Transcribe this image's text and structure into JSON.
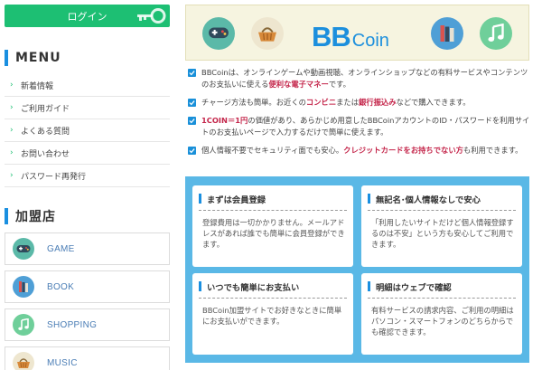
{
  "sidebar": {
    "login_label": "ログイン",
    "menu_title": "MENU",
    "menu_items": [
      "新着情報",
      "ご利用ガイド",
      "よくある質問",
      "お問い合わせ",
      "パスワード再発行"
    ],
    "shops_title": "加盟店",
    "shops": [
      {
        "label": "GAME",
        "icon": "gamepad-icon"
      },
      {
        "label": "BOOK",
        "icon": "books-icon"
      },
      {
        "label": "SHOPPING",
        "icon": "music-note-icon"
      },
      {
        "label": "MUSIC",
        "icon": "basket-icon"
      }
    ]
  },
  "banner": {
    "logo_bb": "BB",
    "logo_coin": "Coin",
    "icons": [
      "gamepad-icon",
      "basket-icon",
      "books-icon",
      "music-note-icon"
    ]
  },
  "features": [
    {
      "parts": [
        {
          "t": "BBCoinは、オンラインゲームや動画視聴、オンラインショップなどの有料サービスやコンテンツのお支払いに使える"
        },
        {
          "t": "便利な電子マネー",
          "hl": true
        },
        {
          "t": "です。"
        }
      ]
    },
    {
      "parts": [
        {
          "t": "チャージ方法も簡単。お近くの"
        },
        {
          "t": "コンビニ",
          "hl": true
        },
        {
          "t": "または"
        },
        {
          "t": "銀行振込み",
          "hl": true
        },
        {
          "t": "などで購入できます。"
        }
      ]
    },
    {
      "parts": [
        {
          "t": "1COIN＝1円",
          "hl": true
        },
        {
          "t": "の価値があり、あらかじめ用意したBBCoinアカウントのID・パスワードを利用サイトのお支払いページで入力するだけで簡単に使えます。"
        }
      ]
    },
    {
      "parts": [
        {
          "t": "個人情報不要でセキュリティ面でも安心。"
        },
        {
          "t": "クレジットカードをお持ちでない方",
          "hl": true
        },
        {
          "t": "も利用できます。"
        }
      ]
    }
  ],
  "cards": [
    {
      "title": "まずは会員登録",
      "body": "登録費用は一切かかりません。メールアドレスがあれば誰でも簡単に会員登録ができます。"
    },
    {
      "title": "無記名･個人情報なしで安心",
      "body": "「利用したいサイトだけど個人情報登録するのは不安」という方も安心してご利用できます。"
    },
    {
      "title": "いつでも簡単にお支払い",
      "body": "BBCoin加盟サイトでお好きなときに簡単にお支払いができます。"
    },
    {
      "title": "明細はウェブで確認",
      "body": "有料サービスの請求内容、ご利用の明細はパソコン・スマートフォンのどちらからでも確認できます。"
    }
  ],
  "colors": {
    "accent_green": "#1dbf73",
    "accent_blue": "#1a8fe0",
    "highlight_red": "#c4254a",
    "panel_blue": "#5ab8e6"
  }
}
